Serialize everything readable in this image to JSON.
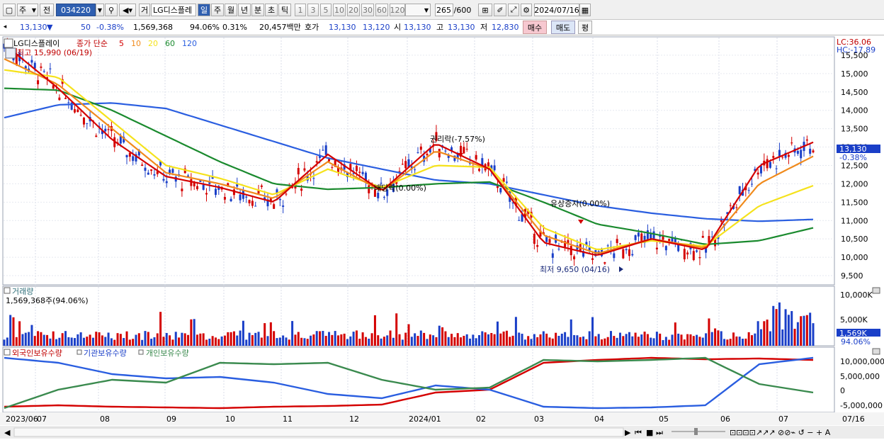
{
  "toolbar": {
    "type_value": "주",
    "prev_label": "전",
    "code_value": "034220",
    "sound_label": "거",
    "stock_name": "LG디스플레",
    "periods": [
      "일",
      "주",
      "월",
      "년",
      "분",
      "초",
      "틱"
    ],
    "active_period": "일",
    "minute_steps": [
      "1",
      "3",
      "5",
      "10",
      "20",
      "30",
      "60",
      "120"
    ],
    "count_value": "265",
    "count_max": "/600",
    "date_value": "2024/07/16"
  },
  "quote": {
    "price": "13,130",
    "direction": "▼",
    "change": "50",
    "change_pct": "-0.38%",
    "volume": "1,569,368",
    "volume_ratio": "94.06%",
    "turnover_pct": "0.31%",
    "amount": "20,457백만",
    "ask_label": "호가",
    "ask": "13,130",
    "bid": "13,120",
    "open_label": "시",
    "open": "13,130",
    "high_label": "고",
    "high": "13,130",
    "low_label": "저",
    "low": "12,830",
    "buy_label": "매수",
    "sell_label": "매도",
    "eval_label": "평"
  },
  "price_panel": {
    "title": "LG디스플레이",
    "ma_label": "종가 단순",
    "ma_periods": [
      "5",
      "10",
      "20",
      "60",
      "120"
    ],
    "ma_colors": [
      "#d40000",
      "#f08a1c",
      "#f5e21c",
      "#1a8a2e",
      "#2a5ee0"
    ],
    "high_note": "최고 15,990 (06/19)",
    "lc_label": "LC:36.06",
    "hc_label": "HC:-17.89",
    "current_price_tag": "13,130",
    "current_change_tag": "-0.38%",
    "annotations": {
      "rights": "권리락(-7.57%)",
      "dividend": "배당락(0.00%)",
      "capital": "유상증자(0.00%)",
      "low_note": "최저 9,650 (04/16)"
    }
  },
  "volume_panel": {
    "title": "거래량",
    "value_label": "1,569,368주(94.06%)",
    "current_tag": "1,569K",
    "current_ratio": "94.06%",
    "axis_labels": [
      "10,000K",
      "5,000K"
    ]
  },
  "holders_panel": {
    "series_labels": [
      "외국인보유수량",
      "기관보유수량",
      "개인보유수량"
    ],
    "series_colors": [
      "#d40000",
      "#2a5ee0",
      "#3a8a4e"
    ],
    "axis_labels": [
      "10,000,000",
      "5,000,000",
      "0",
      "-5,000,000"
    ]
  },
  "x_axis": {
    "labels": [
      "2023/06",
      "07",
      "08",
      "09",
      "10",
      "11",
      "12",
      "2024/01",
      "02",
      "03",
      "04",
      "05",
      "06",
      "07",
      "07/16"
    ]
  },
  "chart_data": {
    "type": "line",
    "title": "LG디스플레이",
    "x": [
      "2023/06",
      "2023/07",
      "2023/08",
      "2023/09",
      "2023/10",
      "2023/11",
      "2023/12",
      "2024/01",
      "2024/02",
      "2024/03",
      "2024/04",
      "2024/05",
      "2024/06",
      "2024/07",
      "07/16"
    ],
    "ylim": [
      9250,
      16000
    ],
    "yticks": [
      9500,
      10000,
      10500,
      11000,
      11500,
      12000,
      12500,
      13000,
      13500,
      14000,
      14500,
      15000,
      15500
    ],
    "series": [
      {
        "name": "5",
        "color": "#d40000",
        "values": [
          15800,
          14600,
          13200,
          12200,
          11900,
          11500,
          12800,
          11800,
          13100,
          12400,
          10400,
          10050,
          10500,
          10200,
          12500,
          13130
        ]
      },
      {
        "name": "10",
        "color": "#f08a1c",
        "values": [
          15400,
          14700,
          13500,
          12300,
          12000,
          11600,
          12600,
          11800,
          12900,
          12400,
          10600,
          10100,
          10500,
          10250,
          12000,
          12750
        ]
      },
      {
        "name": "20",
        "color": "#f5e21c",
        "values": [
          15100,
          14900,
          13700,
          12500,
          12150,
          11700,
          12400,
          11900,
          12500,
          12450,
          10800,
          10200,
          10450,
          10300,
          11400,
          11950
        ]
      },
      {
        "name": "60",
        "color": "#1a8a2e",
        "values": [
          14600,
          14550,
          14000,
          13300,
          12600,
          12000,
          11850,
          11900,
          12000,
          12050,
          11500,
          10900,
          10650,
          10350,
          10450,
          10800
        ]
      },
      {
        "name": "120",
        "color": "#2a5ee0",
        "values": [
          13800,
          14150,
          14200,
          14050,
          13600,
          13150,
          12700,
          12400,
          12100,
          12000,
          11700,
          11400,
          11200,
          11050,
          10980,
          11030
        ]
      }
    ]
  }
}
